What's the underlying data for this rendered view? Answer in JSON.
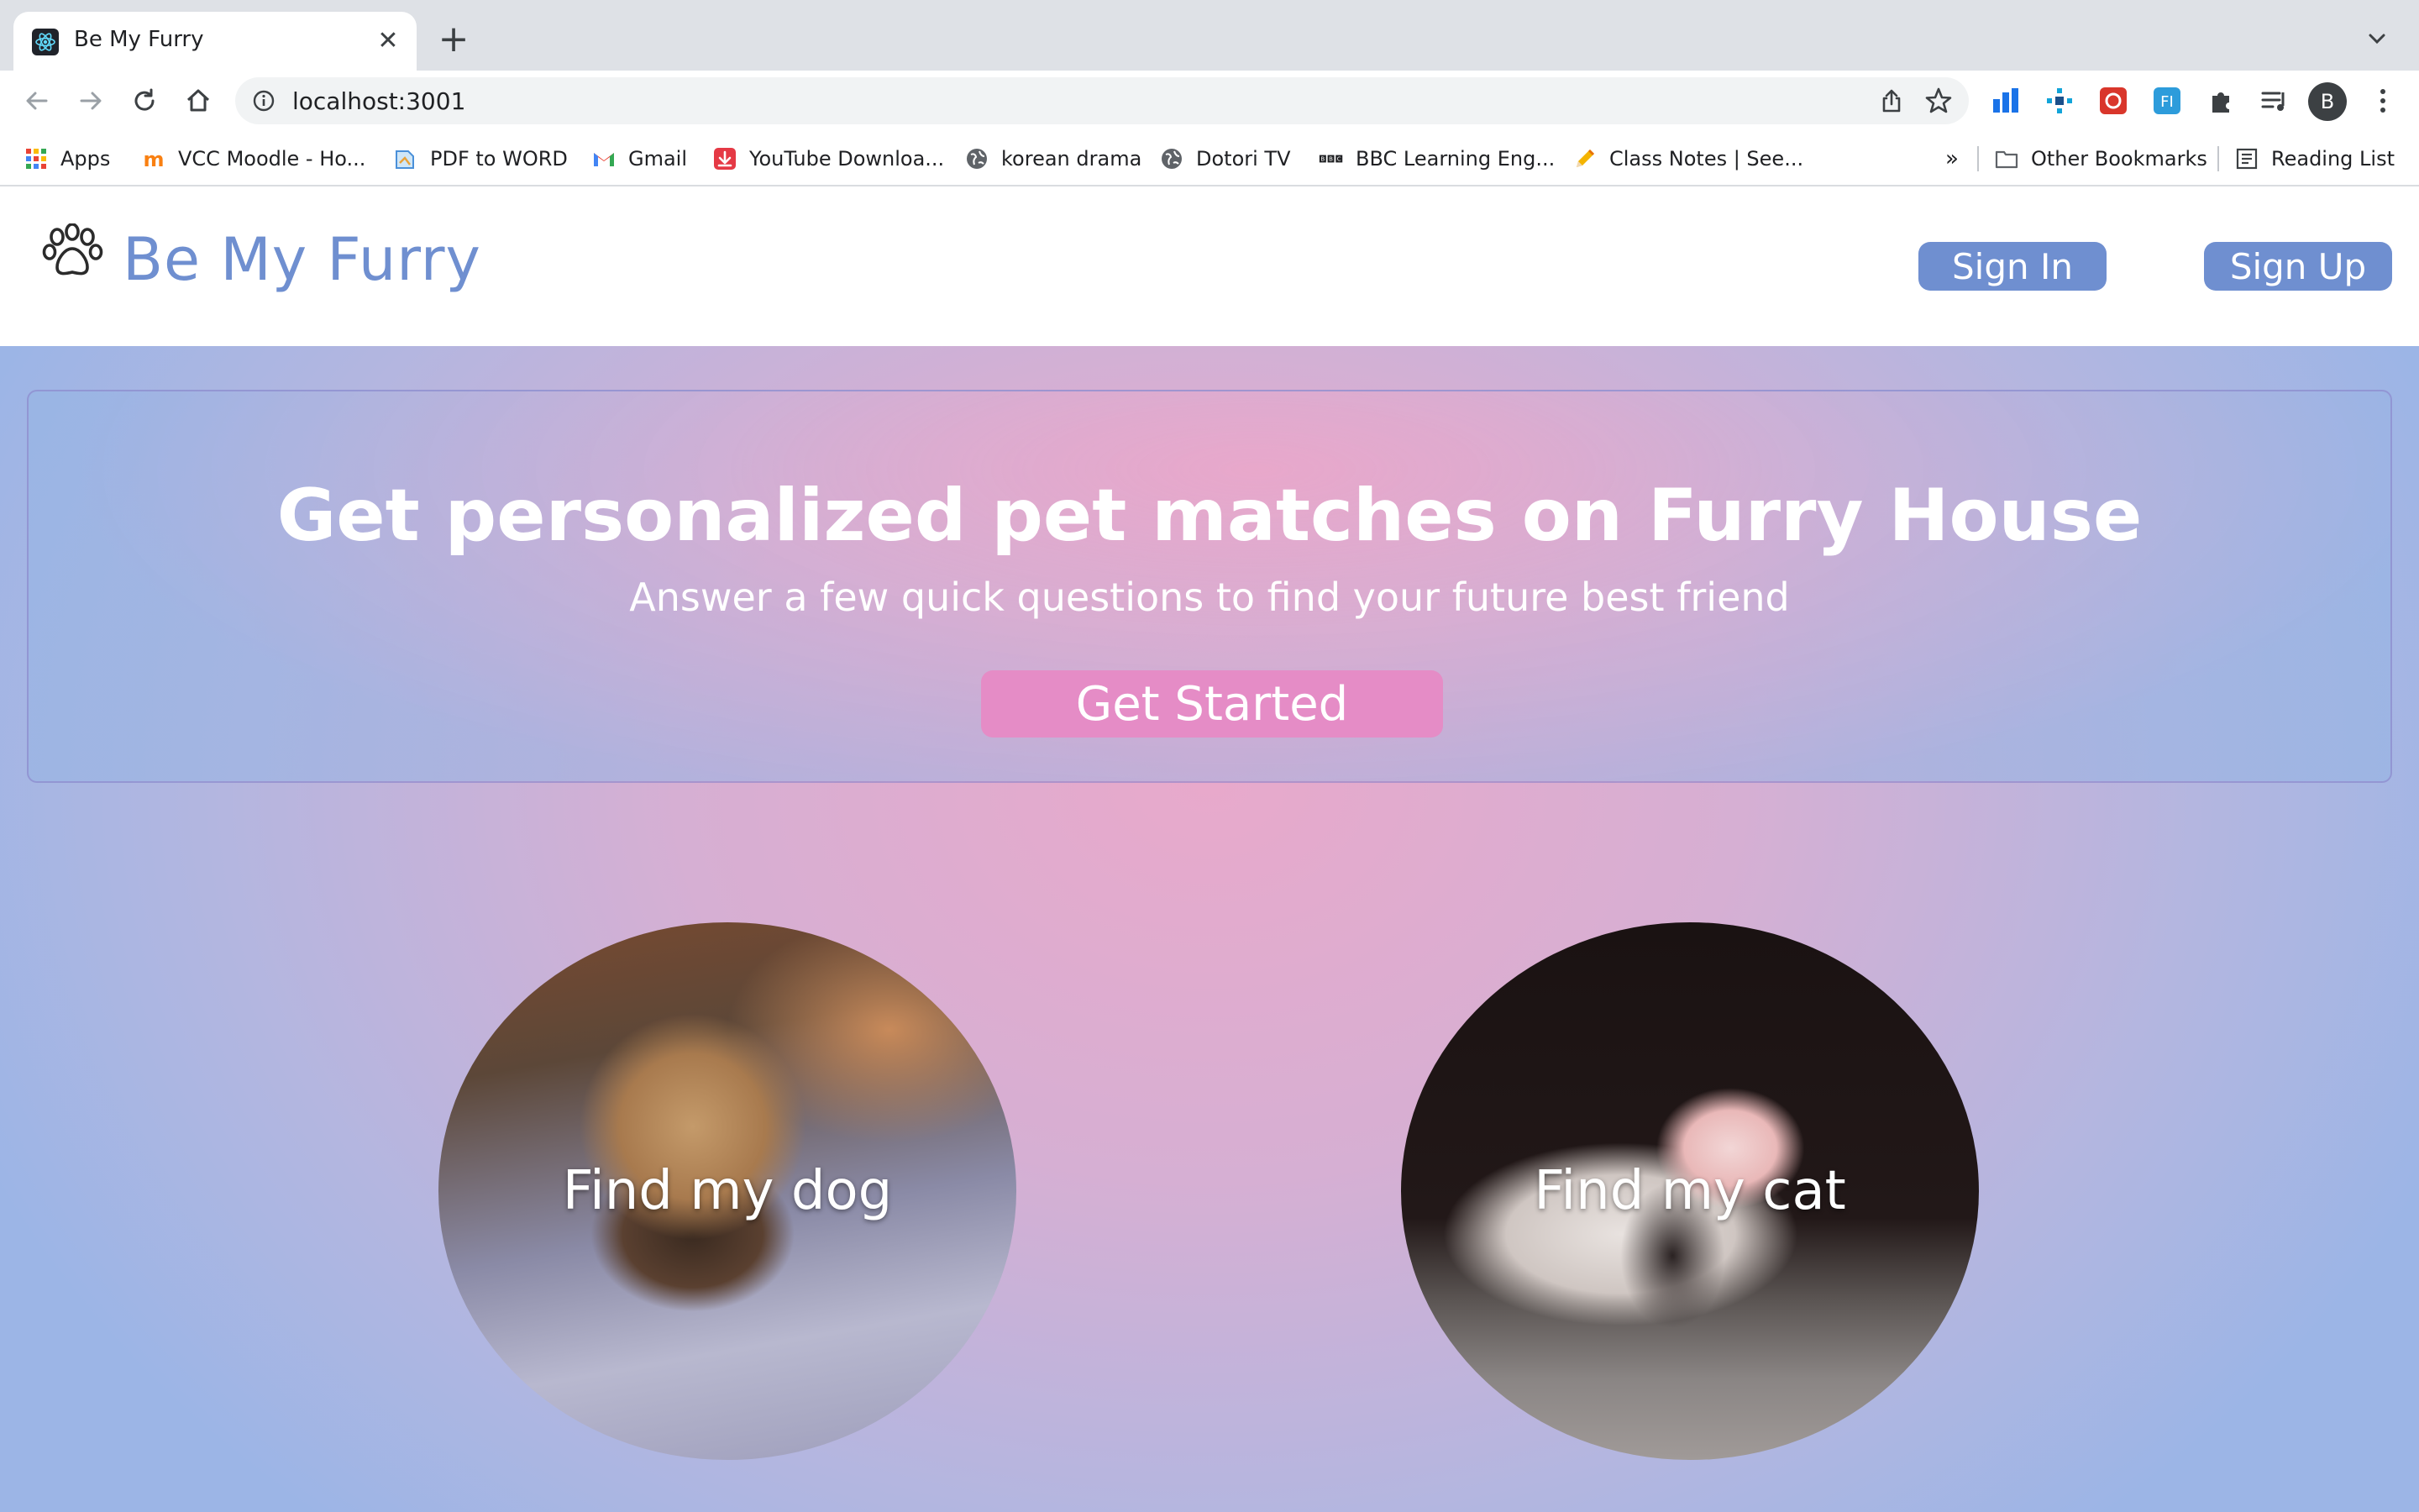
{
  "browser": {
    "tab_title": "Be My Furry",
    "url": "localhost:3001",
    "profile_initial": "B",
    "bookmarks": [
      {
        "label": "Apps",
        "icon": "apps-grid-icon"
      },
      {
        "label": "VCC Moodle - Ho...",
        "icon": "moodle-icon"
      },
      {
        "label": "PDF to WORD",
        "icon": "pdf-icon"
      },
      {
        "label": "Gmail",
        "icon": "gmail-icon"
      },
      {
        "label": "YouTube Downloa...",
        "icon": "download-icon"
      },
      {
        "label": "korean drama",
        "icon": "globe-icon"
      },
      {
        "label": "Dotori TV",
        "icon": "globe-icon"
      },
      {
        "label": "BBC Learning Eng...",
        "icon": "bbc-icon"
      },
      {
        "label": "Class Notes | See...",
        "icon": "pencil-icon"
      }
    ],
    "overflow_label": "»",
    "other_bookmarks": "Other Bookmarks",
    "reading_list": "Reading List"
  },
  "site": {
    "brand": "Be My Furry",
    "sign_in": "Sign In",
    "sign_up": "Sign Up"
  },
  "hero": {
    "title": "Get personalized pet matches on Furry House",
    "subtitle": "Answer a few quick questions to find your future best friend",
    "cta": "Get Started"
  },
  "cards": {
    "dog": "Find my dog",
    "cat": "Find my cat"
  },
  "colors": {
    "brand": "#6f8fd0",
    "cta": "#e58cc6",
    "page_gradient_center": "#e8a9cb",
    "page_gradient_edge": "#9cb5e6"
  }
}
